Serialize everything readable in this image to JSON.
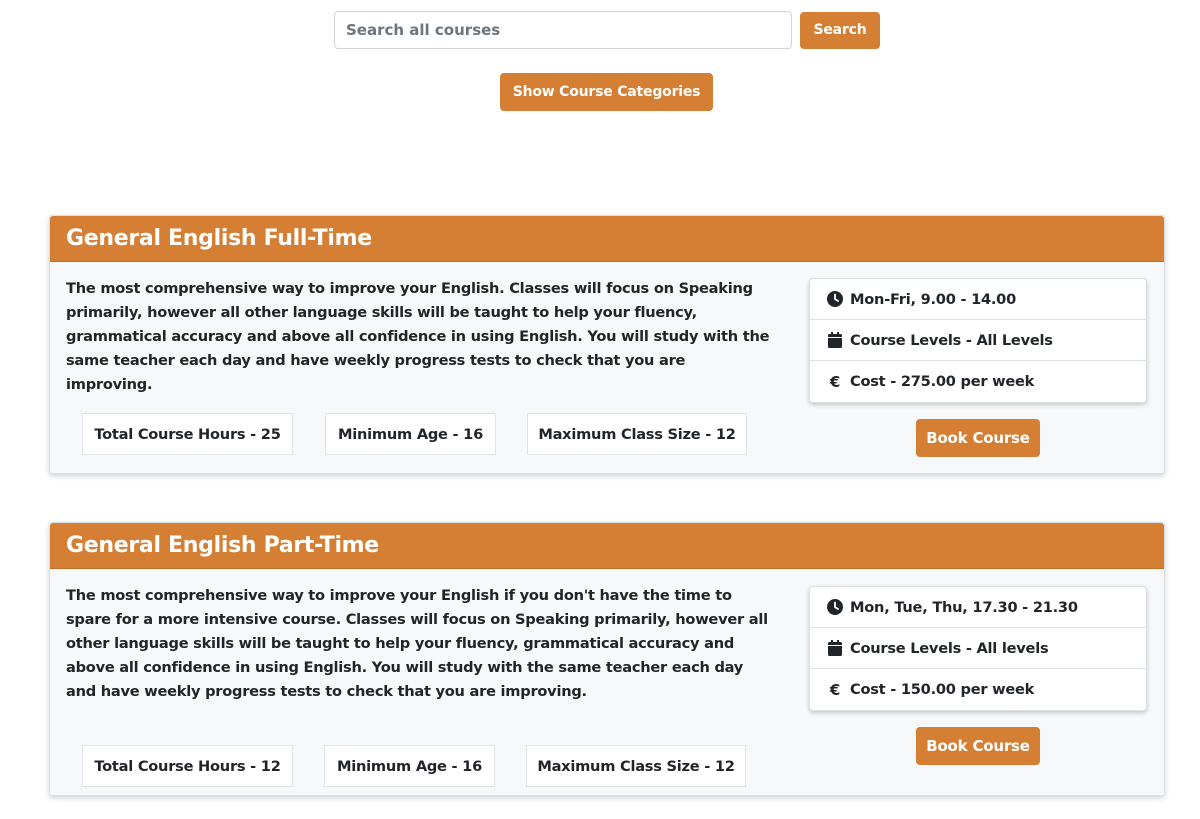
{
  "search": {
    "placeholder": "Search all courses",
    "value": "",
    "button_label": "Search"
  },
  "categories_button": "Show Course Categories",
  "courses": [
    {
      "title": "General English Full-Time",
      "description": "The most comprehensive way to improve your English. Classes will focus on Speaking primarily, however all other language skills will be taught to help your fluency, grammatical accuracy and above all confidence in using English. You will study with the same teacher each day and have weekly progress tests to check that you are improving.",
      "stats": {
        "hours": "Total Course Hours - 25",
        "age": "Minimum Age - 16",
        "class_size": "Maximum Class Size - 12"
      },
      "info": {
        "schedule": "Mon-Fri, 9.00 - 14.00",
        "levels": "Course Levels - All Levels",
        "cost": "Cost - 275.00 per week"
      },
      "book_label": "Book Course"
    },
    {
      "title": "General English Part-Time",
      "description": "The most comprehensive way to improve your English if you don't have the time to spare for a more intensive course. Classes will focus on Speaking primarily, however all other language skills will be taught to help your fluency, grammatical accuracy and above all confidence in using English. You will study with the same teacher each day and have weekly progress tests to check that you are improving.",
      "stats": {
        "hours": "Total Course Hours - 12",
        "age": "Minimum Age - 16",
        "class_size": "Maximum Class Size - 12"
      },
      "info": {
        "schedule": "Mon, Tue, Thu, 17.30 - 21.30",
        "levels": "Course Levels - All levels",
        "cost": "Cost - 150.00 per week"
      },
      "book_label": "Book Course"
    }
  ],
  "icons": {
    "schedule": "clock-icon",
    "levels": "calendar-icon",
    "cost": "euro-icon",
    "euro_glyph": "€"
  },
  "colors": {
    "accent": "#d47f33",
    "card_bg": "#f7f8fa"
  }
}
